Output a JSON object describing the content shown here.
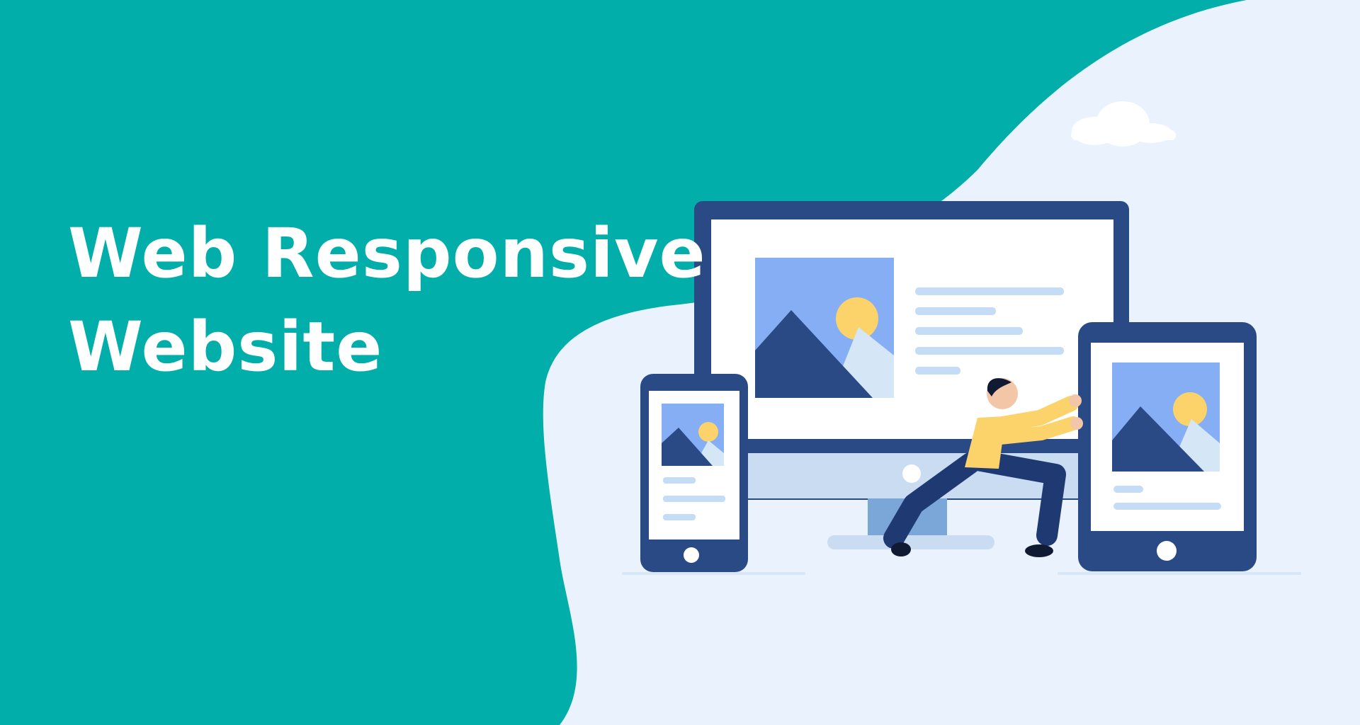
{
  "headline": {
    "line1": "Web Responsive",
    "line2": "Website"
  },
  "colors": {
    "background_teal": "#02aeaa",
    "blob_light": "#eaf3fd",
    "device_frame": "#2a4a86",
    "screen_white": "#ffffff",
    "image_sky": "#86aef5",
    "mountain_dark": "#2a4a86",
    "mountain_light": "#d5e6f7",
    "sun": "#fcd36a",
    "text_lines": "#c4dcf5",
    "person_shirt": "#fcd36a",
    "person_pants": "#1f3a73"
  },
  "illustration": {
    "icons": [
      "cloud-icon",
      "desktop-monitor-icon",
      "smartphone-icon",
      "tablet-icon",
      "landscape-image-icon",
      "person-pushing-icon"
    ]
  }
}
